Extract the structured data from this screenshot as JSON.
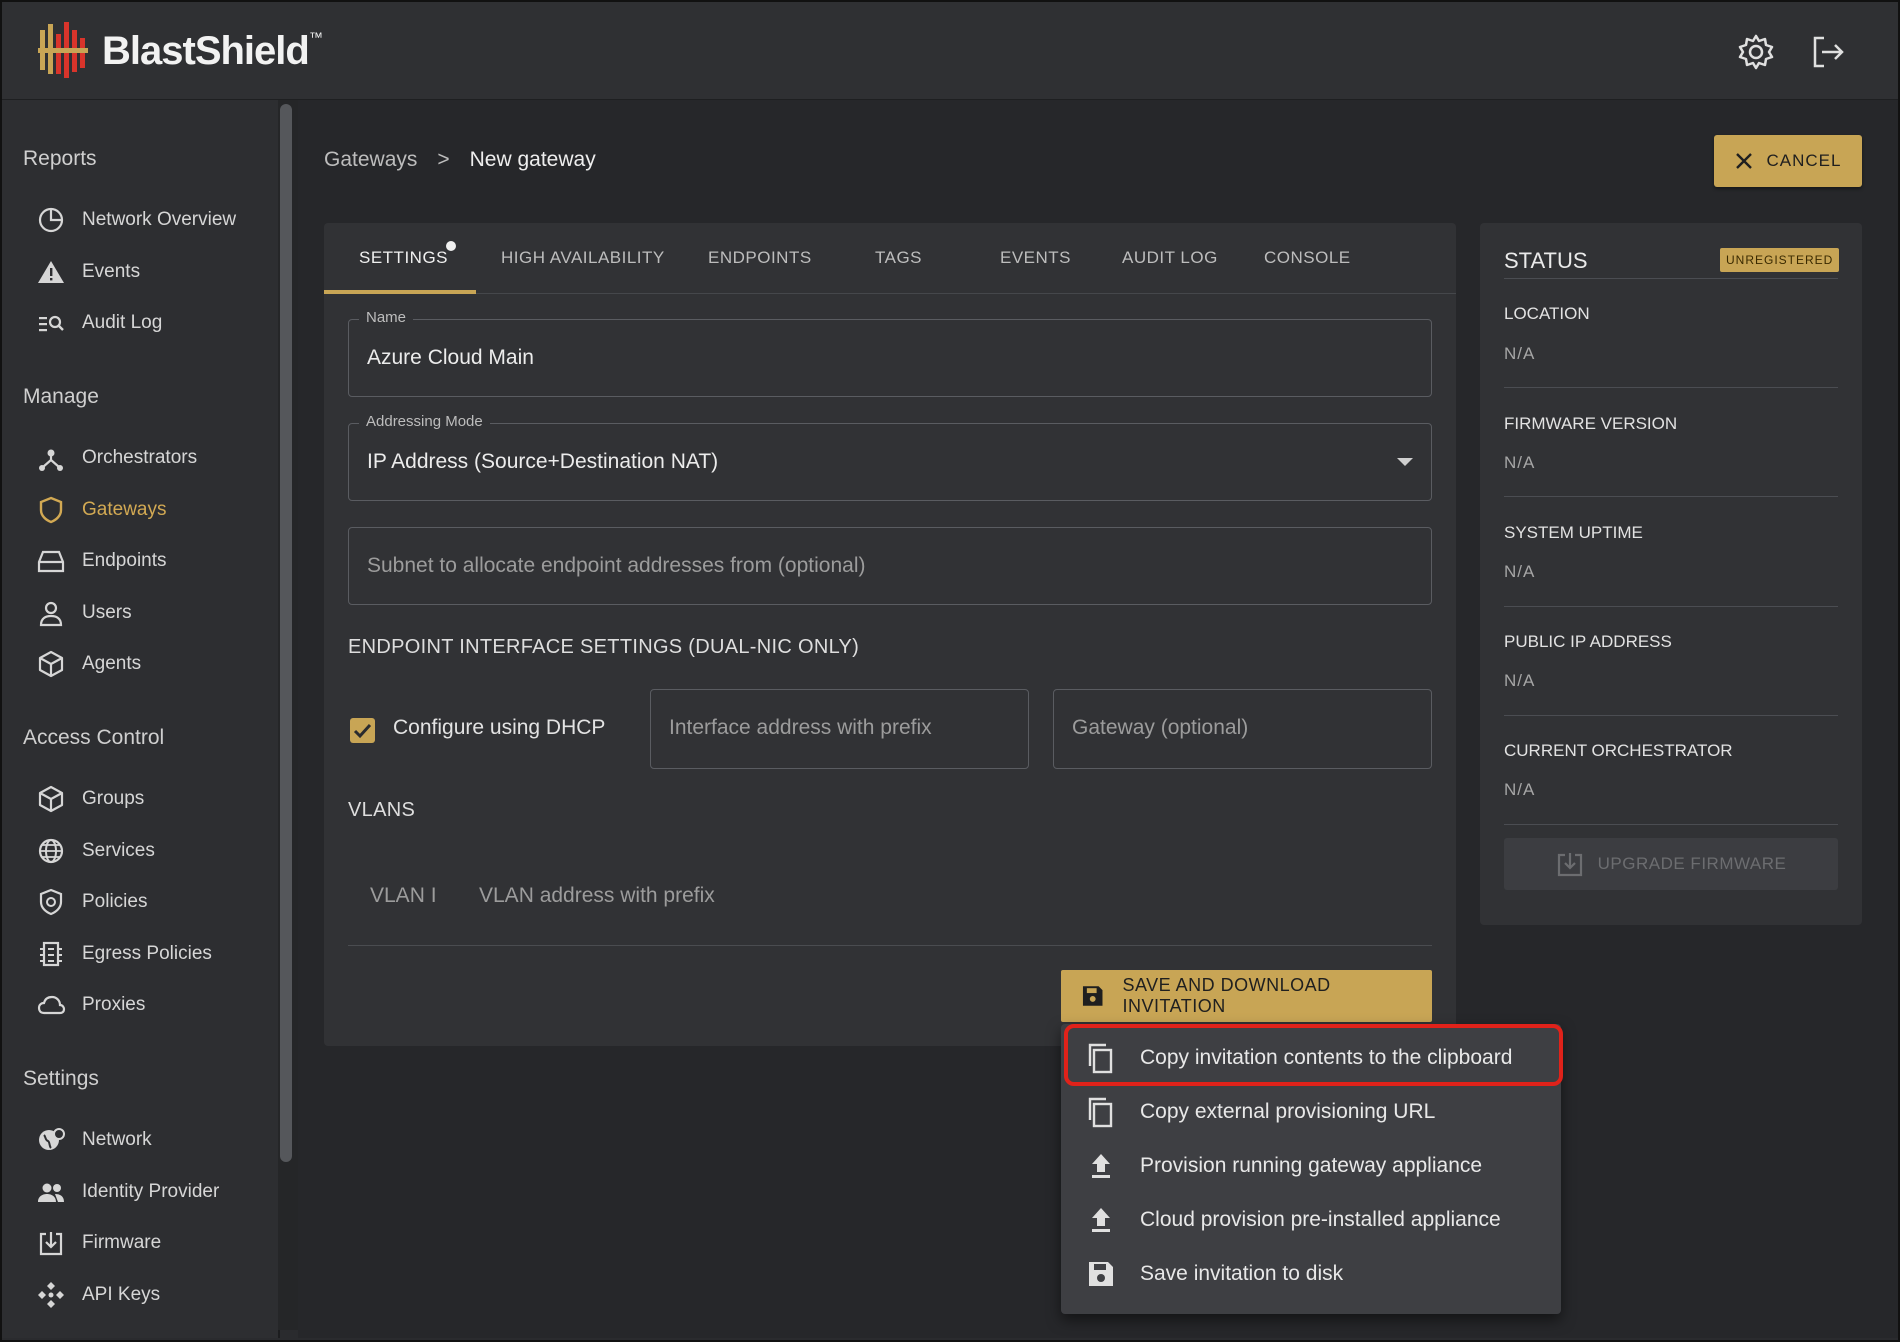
{
  "app": {
    "logo_text": "BlastShield",
    "logo_tm": "™"
  },
  "topbar": {
    "icons": [
      "gear-icon",
      "logout-icon"
    ]
  },
  "sidebar": {
    "sections": [
      {
        "title": "Reports",
        "items": [
          {
            "label": "Network Overview",
            "icon": "pie-chart-icon"
          },
          {
            "label": "Events",
            "icon": "warning-icon"
          },
          {
            "label": "Audit Log",
            "icon": "search-list-icon"
          }
        ]
      },
      {
        "title": "Manage",
        "items": [
          {
            "label": "Orchestrators",
            "icon": "hub-icon"
          },
          {
            "label": "Gateways",
            "icon": "shield-icon",
            "active": true
          },
          {
            "label": "Endpoints",
            "icon": "drive-icon"
          },
          {
            "label": "Users",
            "icon": "user-icon"
          },
          {
            "label": "Agents",
            "icon": "cube-icon"
          }
        ]
      },
      {
        "title": "Access Control",
        "items": [
          {
            "label": "Groups",
            "icon": "cube-icon"
          },
          {
            "label": "Services",
            "icon": "globe-icon"
          },
          {
            "label": "Policies",
            "icon": "shield-lock-icon"
          },
          {
            "label": "Egress Policies",
            "icon": "egress-icon"
          },
          {
            "label": "Proxies",
            "icon": "cloud-icon"
          }
        ]
      },
      {
        "title": "Settings",
        "items": [
          {
            "label": "Network",
            "icon": "globe-gear-icon"
          },
          {
            "label": "Identity Provider",
            "icon": "users-icon"
          },
          {
            "label": "Firmware",
            "icon": "download-box-icon"
          },
          {
            "label": "API Keys",
            "icon": "keys-icon"
          }
        ]
      }
    ]
  },
  "breadcrumb": {
    "parent": "Gateways",
    "separator": ">",
    "current": "New gateway"
  },
  "cancel_label": "CANCEL",
  "tabs": [
    "SETTINGS",
    "HIGH AVAILABILITY",
    "ENDPOINTS",
    "TAGS",
    "EVENTS",
    "AUDIT LOG",
    "CONSOLE"
  ],
  "form": {
    "name_label": "Name",
    "name_value": "Azure Cloud Main",
    "addr_label": "Addressing Mode",
    "addr_value": "IP Address (Source+Destination NAT)",
    "subnet_placeholder": "Subnet to allocate endpoint addresses from (optional)",
    "endpoint_section": "ENDPOINT INTERFACE SETTINGS (DUAL-NIC ONLY)",
    "dhcp_label": "Configure using DHCP",
    "dhcp_checked": true,
    "iface_placeholder": "Interface address with prefix",
    "gateway_placeholder": "Gateway (optional)",
    "vlans_section": "VLANS",
    "vlan_id_placeholder": "VLAN I",
    "vlan_addr_placeholder": "VLAN address with prefix"
  },
  "save_button": "SAVE AND DOWNLOAD INVITATION",
  "menu": [
    {
      "label": "Copy invitation contents to the clipboard",
      "icon": "copy-icon"
    },
    {
      "label": "Copy external provisioning URL",
      "icon": "copy-icon"
    },
    {
      "label": "Provision running gateway appliance",
      "icon": "upload-icon"
    },
    {
      "label": "Cloud provision pre-installed appliance",
      "icon": "upload-icon"
    },
    {
      "label": "Save invitation to disk",
      "icon": "save-icon"
    }
  ],
  "status": {
    "title": "STATUS",
    "badge": "UNREGISTERED",
    "fields": [
      {
        "label": "LOCATION",
        "value": "N/A"
      },
      {
        "label": "FIRMWARE VERSION",
        "value": "N/A"
      },
      {
        "label": "SYSTEM UPTIME",
        "value": "N/A"
      },
      {
        "label": "PUBLIC IP ADDRESS",
        "value": "N/A"
      },
      {
        "label": "CURRENT ORCHESTRATOR",
        "value": "N/A"
      }
    ],
    "upgrade_label": "UPGRADE FIRMWARE"
  },
  "colors": {
    "accent": "#c8a555",
    "highlight": "#e0221a",
    "bg": "#26272a"
  }
}
